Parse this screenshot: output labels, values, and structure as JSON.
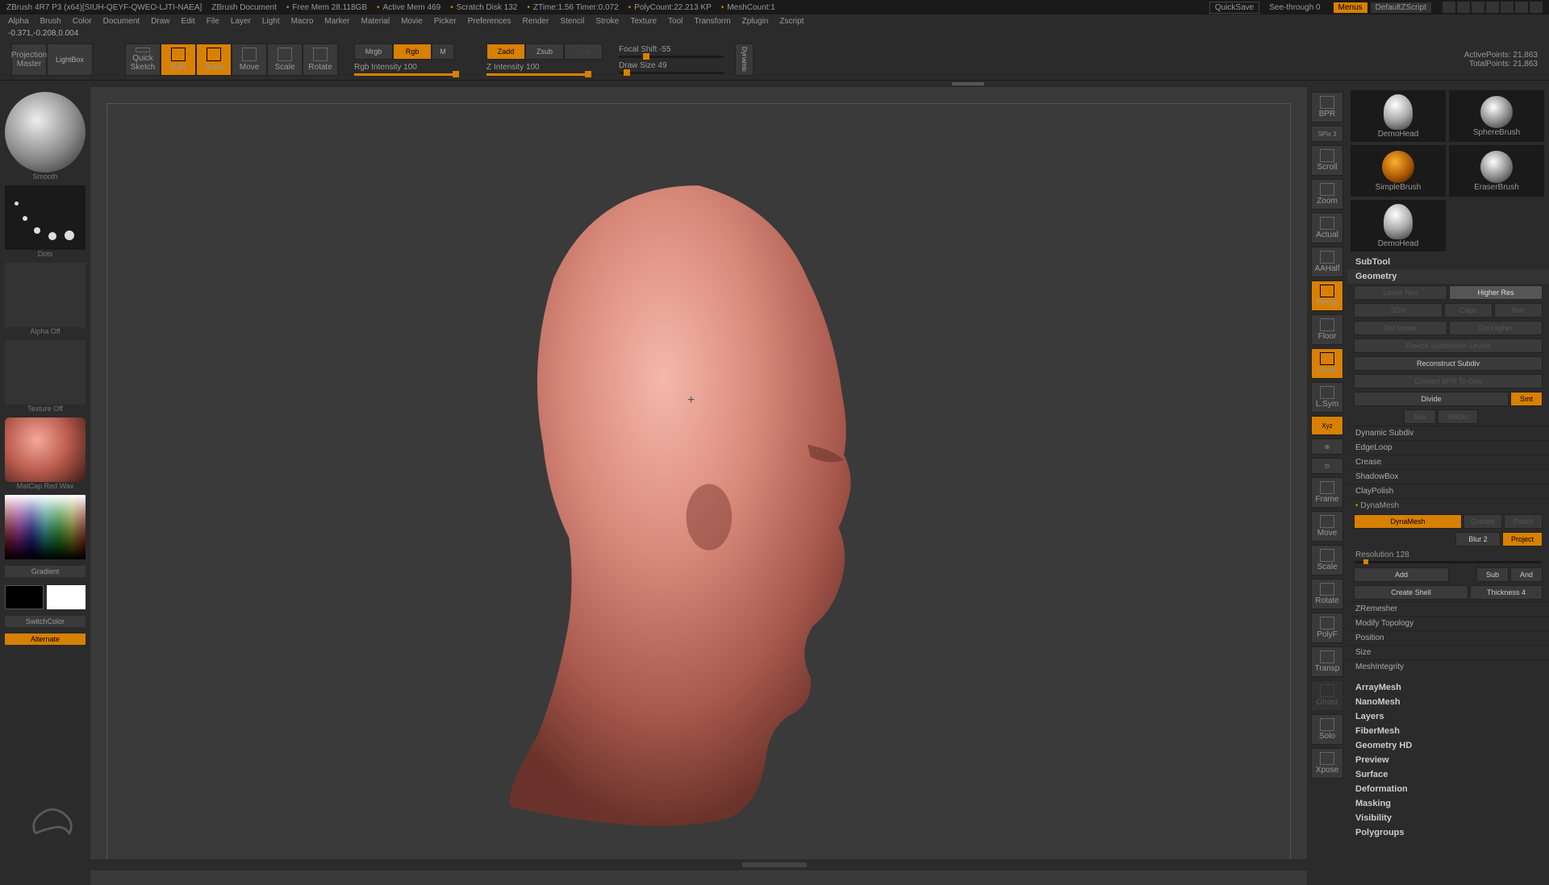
{
  "titlebar": {
    "app": "ZBrush 4R7 P3 (x64)[SIUH-QEYF-QWEO-LJTI-NAEA]",
    "doc": "ZBrush Document",
    "free_mem": "Free Mem 28.118GB",
    "active_mem": "Active Mem 469",
    "scratch": "Scratch Disk 132",
    "ztime": "ZTime:1.56 Timer:0.072",
    "polycount": "PolyCount:22.213 KP",
    "meshcount": "MeshCount:1",
    "quicksave": "QuickSave",
    "seethrough": "See-through   0",
    "menus": "Menus",
    "script": "DefaultZScript"
  },
  "menubar": [
    "Alpha",
    "Brush",
    "Color",
    "Document",
    "Draw",
    "Edit",
    "File",
    "Layer",
    "Light",
    "Macro",
    "Marker",
    "Material",
    "Movie",
    "Picker",
    "Preferences",
    "Render",
    "Stencil",
    "Stroke",
    "Texture",
    "Tool",
    "Transform",
    "Zplugin",
    "Zscript"
  ],
  "coords": "-0.371,-0.208,0.004",
  "toolbar": {
    "projection": "Projection\nMaster",
    "lightbox": "LightBox",
    "quicksketch": "Quick\nSketch",
    "edit": "Edit",
    "draw": "Draw",
    "move": "Move",
    "scale": "Scale",
    "rotate": "Rotate",
    "mrgb": "Mrgb",
    "rgb": "Rgb",
    "m": "M",
    "rgb_intensity_label": "Rgb Intensity 100",
    "zadd": "Zadd",
    "zsub": "Zsub",
    "zcut": "Zcut",
    "z_intensity_label": "Z Intensity 100",
    "focal_shift": "Focal Shift -55",
    "draw_size": "Draw Size 49",
    "dynamic": "Dynamic",
    "active_points": "ActivePoints: 21,863",
    "total_points": "TotalPoints: 21,863"
  },
  "left": {
    "brush_label": "Smooth",
    "stroke_label": "Dots",
    "alpha_label": "Alpha Off",
    "texture_label": "Texture Off",
    "material_label": "MatCap Red Wax",
    "gradient": "Gradient",
    "switchcolor": "SwitchColor",
    "alternate": "Alternate"
  },
  "right_strip": {
    "bpr": "BPR",
    "spix": "SPix 3",
    "scroll": "Scroll",
    "zoom": "Zoom",
    "actual": "Actual",
    "aahalf": "AAHalf",
    "persp": "Persp",
    "floor": "Floor",
    "local": "Local",
    "lsym": "L.Sym",
    "xyz": "Xyz",
    "frame": "Frame",
    "move": "Move",
    "scale": "Scale",
    "rotate": "Rotate",
    "polyf": "PolyF",
    "transp": "Transp",
    "ghost": "Ghost",
    "solo": "Solo",
    "xpose": "Xpose"
  },
  "tool_icons": {
    "a": "DemoHead",
    "b": "SphereBrush",
    "c": "SimpleBrush",
    "d": "EraserBrush",
    "e": "DemoHead"
  },
  "geometry": {
    "subtool": "SubTool",
    "geometry": "Geometry",
    "lower_res": "Lower Res",
    "higher_res": "Higher Res",
    "sdiv": "SDiv",
    "cage": "Cage",
    "rstr": "Rstr",
    "del_lower": "Del Lower",
    "del_higher": "Del Higher",
    "freeze": "Freeze Subdivision Levels",
    "reconstruct": "Reconstruct Subdiv",
    "convert": "Convert BPR To Geo",
    "divide": "Divide",
    "smt": "Smt",
    "suv": "Suv",
    "rediv": "ReDiv",
    "dynamic_subdiv": "Dynamic Subdiv",
    "edgeloop": "EdgeLoop",
    "crease": "Crease",
    "shadowbox": "ShadowBox",
    "claypolish": "ClayPolish",
    "dynamesh_h": "DynaMesh",
    "dynamesh": "DynaMesh",
    "groups": "Groups",
    "polish": "Polish",
    "blur": "Blur 2",
    "project": "Project",
    "resolution": "Resolution 128",
    "add": "Add",
    "sub": "Sub",
    "and": "And",
    "create_shell": "Create Shell",
    "thickness": "Thickness 4",
    "zremesher": "ZRemesher",
    "modify_topo": "Modify Topology",
    "position": "Position",
    "size": "Size",
    "mesh_integrity": "MeshIntegrity"
  },
  "right_sections": [
    "ArrayMesh",
    "NanoMesh",
    "Layers",
    "FiberMesh",
    "Geometry HD",
    "Preview",
    "Surface",
    "Deformation",
    "Masking",
    "Visibility",
    "Polygroups"
  ]
}
